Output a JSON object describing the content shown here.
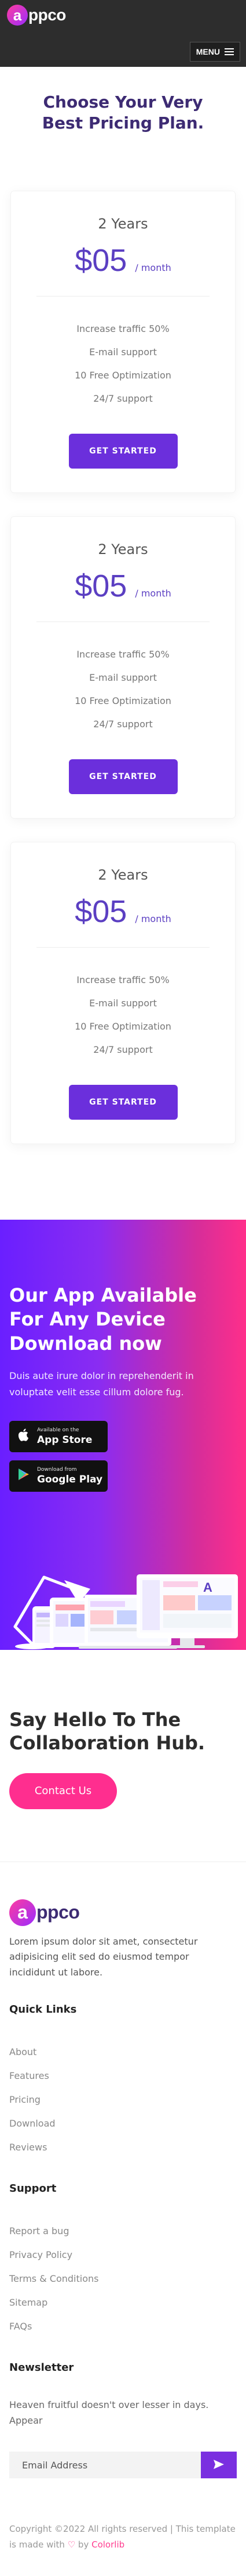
{
  "brand": {
    "badge": "a",
    "name": "ppco"
  },
  "header": {
    "menu_label": "MENU"
  },
  "pricing": {
    "title": "Choose Your Very Best Pricing Plan.",
    "plans": [
      {
        "term": "2 Years",
        "amount": "$05",
        "period": "/ month",
        "features": [
          "Increase traffic 50%",
          "E-mail support",
          "10 Free Optimization",
          "24/7 support"
        ],
        "button": "GET STARTED"
      },
      {
        "term": "2 Years",
        "amount": "$05",
        "period": "/ month",
        "features": [
          "Increase traffic 50%",
          "E-mail support",
          "10 Free Optimization",
          "24/7 support"
        ],
        "button": "GET STARTED"
      },
      {
        "term": "2 Years",
        "amount": "$05",
        "period": "/ month",
        "features": [
          "Increase traffic 50%",
          "E-mail support",
          "10 Free Optimization",
          "24/7 support"
        ],
        "button": "GET STARTED"
      }
    ]
  },
  "app": {
    "title": "Our App Available For Any Device Download now",
    "text": "Duis aute irure dolor in reprehenderit in voluptate velit esse cillum dolore fug.",
    "app_store": {
      "small": "Available on the",
      "big": "App Store",
      "icon": "apple-icon"
    },
    "google_play": {
      "small": "Download from",
      "big": "Google Play",
      "icon": "google-play-icon"
    }
  },
  "hello": {
    "title": "Say Hello To The Collaboration Hub.",
    "button": "Contact Us"
  },
  "footer": {
    "about": "Lorem ipsum dolor sit amet, consectetur adipisicing elit sed do eiusmod tempor incididunt ut labore.",
    "quick_links_heading": "Quick Links",
    "quick_links": [
      "About",
      "Features",
      "Pricing",
      "Download",
      "Reviews"
    ],
    "support_heading": "Support",
    "support_links": [
      "Report a bug",
      "Privacy Policy",
      "Terms & Conditions",
      "Sitemap",
      "FAQs"
    ],
    "newsletter_heading": "Newsletter",
    "newsletter_text": "Heaven fruitful doesn't over lesser in days. Appear",
    "email_placeholder": "Email Address",
    "copyright_text": "Copyright ©2022 All rights reserved | This template is made with",
    "copyright_by": "by",
    "copyright_brand": "Colorlib"
  },
  "colors": {
    "primary": "#6b2fdc",
    "accent_pink": "#ff2e8f",
    "heading": "#3d2b73",
    "header_bg": "#2d2d2d"
  }
}
